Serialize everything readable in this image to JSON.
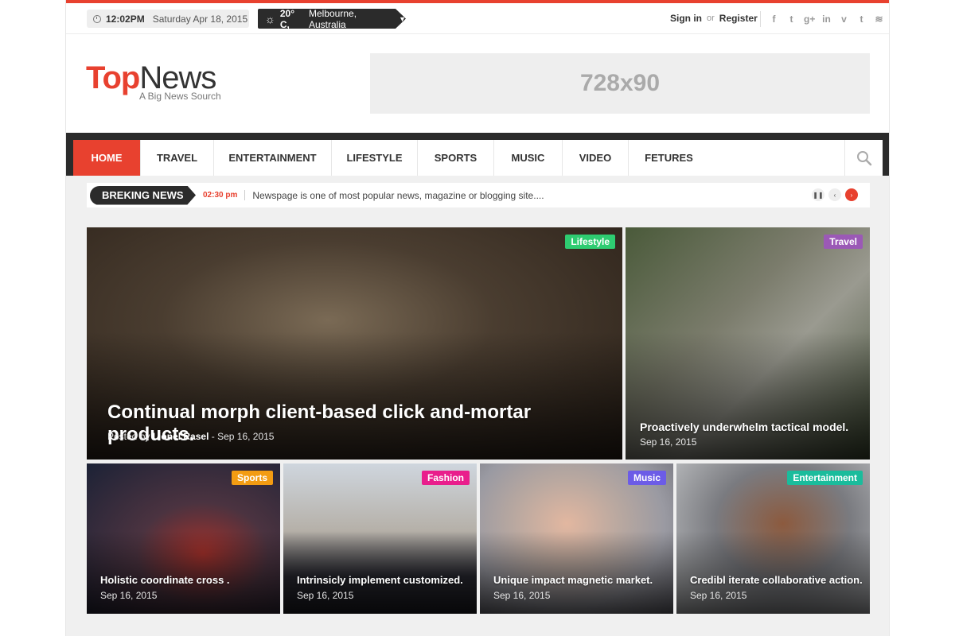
{
  "topbar": {
    "time": "12:02PM",
    "date": "Saturday Apr 18, 2015",
    "weather": {
      "temp": "20° C,",
      "location": "Melbourne, Australia"
    },
    "sign_in": "Sign in",
    "or": "or",
    "register": "Register",
    "social": [
      {
        "icon": "facebook-icon",
        "glyph": "f"
      },
      {
        "icon": "twitter-icon",
        "glyph": "t"
      },
      {
        "icon": "google-plus-icon",
        "glyph": "g+"
      },
      {
        "icon": "linkedin-icon",
        "glyph": "in"
      },
      {
        "icon": "vimeo-icon",
        "glyph": "v"
      },
      {
        "icon": "tumblr-icon",
        "glyph": "t"
      },
      {
        "icon": "rss-icon",
        "glyph": "⌇"
      }
    ]
  },
  "header": {
    "logo_top": "Top",
    "logo_news": "News",
    "tagline": "A Big News Sourch",
    "ad_label": "728x90"
  },
  "nav": {
    "items": [
      "HOME",
      "TRAVEL",
      "ENTERTAINMENT",
      "LIFESTYLE",
      "SPORTS",
      "MUSIC",
      "VIDEO",
      "FETURES"
    ],
    "active_index": 0
  },
  "breaking": {
    "label": "BREKING NEWS",
    "time": "02:30 pm",
    "text": "Newspage is one of most popular news, magazine or blogging site...."
  },
  "featured": {
    "main": {
      "category": "Lifestyle",
      "category_color": "#2ecc71",
      "title": "Continual morph client-based click and-mortar products.",
      "posted_by": "Posted by",
      "author": "Lionel Rasel",
      "date": "- Sep 16, 2015"
    },
    "side": {
      "category": "Travel",
      "category_color": "#9b59b6",
      "title": "Proactively underwhelm tactical model.",
      "date": "Sep 16, 2015"
    },
    "bottom": [
      {
        "category": "Sports",
        "category_color": "#f39c12",
        "title": "Holistic coordinate cross .",
        "date": "Sep 16, 2015"
      },
      {
        "category": "Fashion",
        "category_color": "#e91e8c",
        "title": "Intrinsicly implement customized.",
        "date": "Sep 16, 2015"
      },
      {
        "category": "Music",
        "category_color": "#6c5ce7",
        "title": "Unique impact magnetic market.",
        "date": "Sep 16, 2015"
      },
      {
        "category": "Entertainment",
        "category_color": "#1abc9c",
        "title": "Credibl iterate collaborative action.",
        "date": "Sep 16, 2015"
      }
    ]
  },
  "colors": {
    "accent": "#e8412f",
    "dark": "#2b2b2b"
  }
}
